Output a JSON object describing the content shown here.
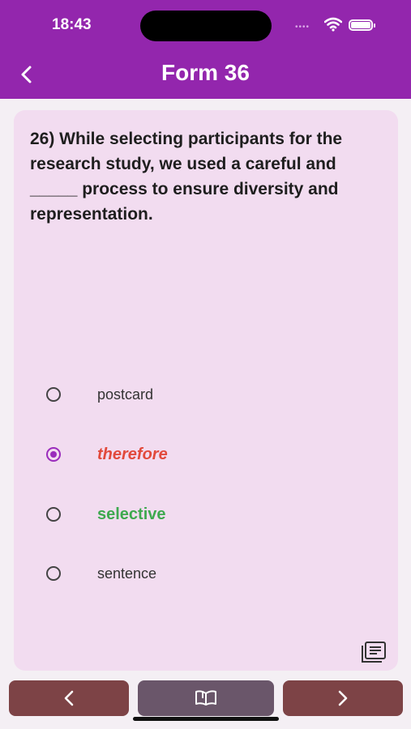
{
  "status_bar": {
    "time": "18:43",
    "signal_dots": "••••",
    "icons": [
      "wifi-icon",
      "battery-icon"
    ]
  },
  "header": {
    "title": "Form 36",
    "back_icon": "chevron-left-icon",
    "background": "#9326ad"
  },
  "question": {
    "text": "26) While selecting participants for the research study, we used a careful and _____ process to ensure diversity and representation."
  },
  "options": [
    {
      "label": "postcard",
      "state": "unselected"
    },
    {
      "label": "therefore",
      "state": "selected-wrong",
      "color": "#e24a3c"
    },
    {
      "label": "selective",
      "state": "correct",
      "color": "#3ea94f"
    },
    {
      "label": "sentence",
      "state": "unselected"
    }
  ],
  "card_actions": {
    "list_icon": "list-icon"
  },
  "bottom_nav": {
    "prev_icon": "chevron-left-icon",
    "book_icon": "book-icon",
    "next_icon": "chevron-right-icon",
    "colors": {
      "prev_next": "#7d4346",
      "book": "#6a566a"
    }
  }
}
